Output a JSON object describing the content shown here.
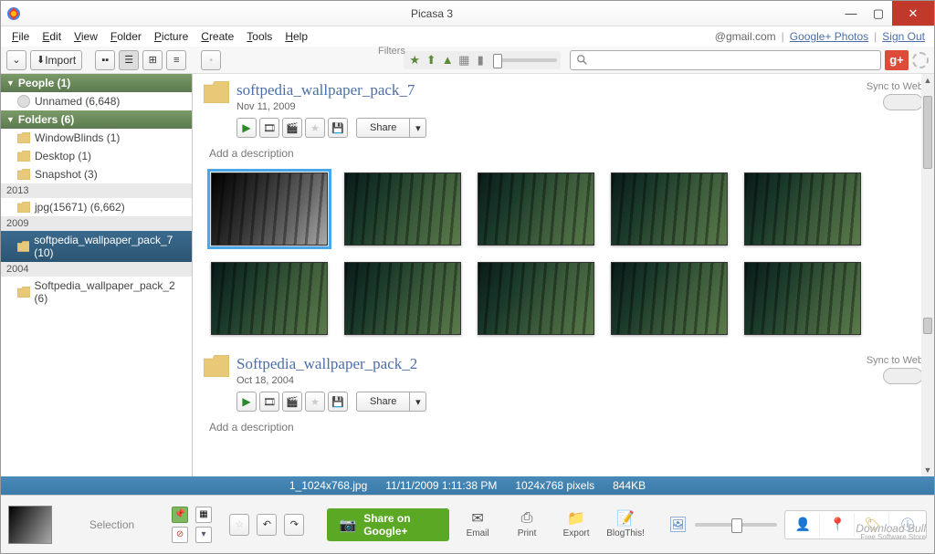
{
  "window": {
    "title": "Picasa 3"
  },
  "menu": {
    "items": [
      "File",
      "Edit",
      "View",
      "Folder",
      "Picture",
      "Create",
      "Tools",
      "Help"
    ],
    "account": "@gmail.com",
    "links": [
      "Google+ Photos",
      "Sign Out"
    ]
  },
  "toolbar": {
    "import": "Import",
    "filters_label": "Filters"
  },
  "sidebar": {
    "people": {
      "title": "People (1)",
      "items": [
        {
          "label": "Unnamed (6,648)"
        }
      ]
    },
    "folders": {
      "title": "Folders (6)",
      "recent": [
        {
          "label": "WindowBlinds (1)"
        },
        {
          "label": "Desktop (1)"
        },
        {
          "label": "Snapshot (3)"
        }
      ],
      "years": [
        {
          "year": "2013",
          "items": [
            {
              "label": "jpg(15671) (6,662)"
            }
          ]
        },
        {
          "year": "2009",
          "items": [
            {
              "label": "softpedia_wallpaper_pack_7 (10)",
              "selected": true
            }
          ]
        },
        {
          "year": "2004",
          "items": [
            {
              "label": "Softpedia_wallpaper_pack_2 (6)"
            }
          ]
        }
      ]
    }
  },
  "albums": [
    {
      "title": "softpedia_wallpaper_pack_7",
      "date": "Nov 11, 2009",
      "sync": "Sync to Web",
      "share": "Share",
      "desc": "Add a description",
      "thumb_count": 10,
      "selected_thumb": 0,
      "bw_thumb": 0
    },
    {
      "title": "Softpedia_wallpaper_pack_2",
      "date": "Oct 18, 2004",
      "sync": "Sync to Web",
      "share": "Share",
      "desc": "Add a description",
      "thumb_count": 0
    }
  ],
  "status": {
    "filename": "1_1024x768.jpg",
    "datetime": "11/11/2009 1:11:38 PM",
    "dimensions": "1024x768 pixels",
    "size": "844KB"
  },
  "bottom": {
    "selection": "Selection",
    "gplus_share": "Share on Google+",
    "actions": [
      "Email",
      "Print",
      "Export",
      "BlogThis!"
    ]
  },
  "watermark": {
    "main": "Download Bull",
    "sub": "Free Software Store"
  }
}
